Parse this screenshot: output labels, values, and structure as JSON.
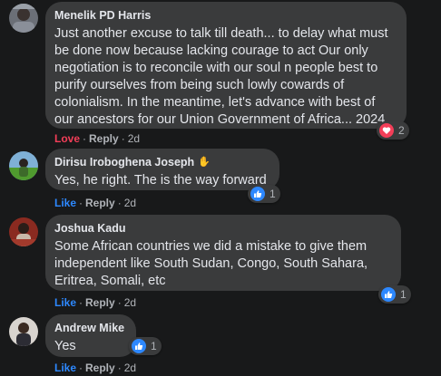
{
  "comments": [
    {
      "author": "Menelik PD Harris",
      "text": "Just another excuse to talk till death... to delay what must\nbe done now because lacking courage to act Our only\nnegotiation is to reconcile with our soul n people best to\npurify ourselves from being such lowly cowards of\ncolonialism. In the meantime, let's advance with best of\nour ancestors for our Union Government of Africa... 2024",
      "reaction_action": "Love",
      "reply": "Reply",
      "age": "2d",
      "reaction_icon": "heart-icon",
      "reaction_count": "2"
    },
    {
      "author": "Dirisu Iroboghena Joseph",
      "text": "Yes, he right. The is the way forward",
      "reaction_action": "Like",
      "reply": "Reply",
      "age": "2d",
      "reaction_icon": "thumbs-up-icon",
      "reaction_count": "1"
    },
    {
      "author": "Joshua Kadu",
      "text": "Some African countries we did a mistake to give them\nindependent like South Sudan, Congo, South Sahara,\nEritrea, Somali, etc",
      "reaction_action": "Like",
      "reply": "Reply",
      "age": "2d",
      "reaction_icon": "thumbs-up-icon",
      "reaction_count": "1"
    },
    {
      "author": "Andrew Mike",
      "text": "Yes",
      "reaction_action": "Like",
      "reply": "Reply",
      "age": "2d",
      "reaction_icon": "thumbs-up-icon",
      "reaction_count": "1"
    }
  ],
  "colors": {
    "background": "#18191a",
    "bubble": "#3a3b3c",
    "love": "#f33e58",
    "like": "#2d88ff"
  }
}
